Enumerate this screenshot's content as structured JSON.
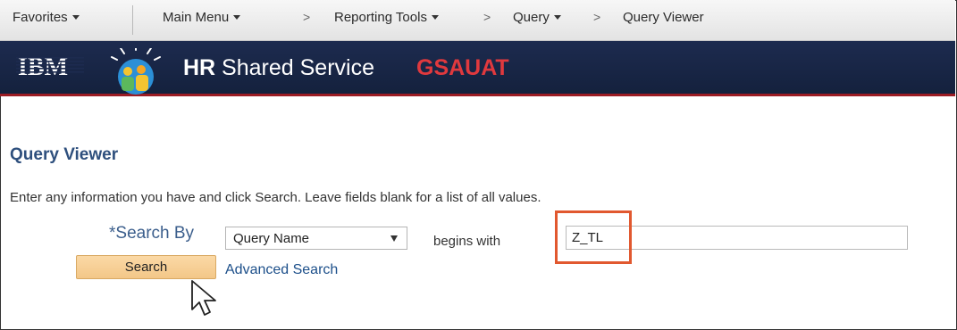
{
  "nav": {
    "favorites": "Favorites",
    "main_menu": "Main Menu",
    "sep": ">",
    "reporting_tools": "Reporting Tools",
    "query": "Query",
    "query_viewer": "Query Viewer"
  },
  "banner": {
    "logo": "IBM",
    "brand_bold": "HR",
    "brand_rest": " Shared Service",
    "environment": "GSAUAT"
  },
  "page": {
    "title": "Query Viewer",
    "instructions": "Enter any information you have and click Search. Leave fields blank for a list of all values."
  },
  "search": {
    "label": "*Search By",
    "search_by_value": "Query Name",
    "operator": "begins with",
    "input_value": "Z_TL",
    "search_button": "Search",
    "advanced_link": "Advanced Search"
  },
  "colors": {
    "banner_bg": "#1d2b4f",
    "env_red": "#e0393e",
    "highlight_orange": "#e1582f",
    "title_blue": "#2e4f7d",
    "button_bg": "#f3c788"
  },
  "icons": [
    "ibm-logo-icon",
    "person-logo-icon",
    "caret-down-icon",
    "mouse-cursor-icon"
  ]
}
